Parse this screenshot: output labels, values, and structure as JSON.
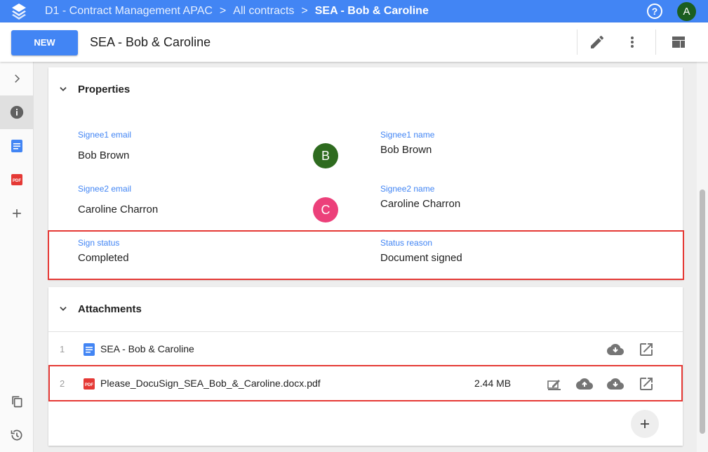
{
  "header": {
    "breadcrumbs": [
      "D1 - Contract Management APAC",
      "All contracts",
      "SEA - Bob & Caroline"
    ],
    "separator": ">",
    "help_icon": "help-circle-icon",
    "help_glyph": "?",
    "user_initial": "A"
  },
  "toolbar": {
    "new_label": "NEW",
    "title": "SEA - Bob & Caroline",
    "edit_icon": "pencil-icon",
    "more_icon": "more-vertical-icon",
    "layout_icon": "view-layout-icon"
  },
  "sidebar": {
    "items": [
      {
        "icon": "chevron-right-icon"
      },
      {
        "icon": "info-icon",
        "active": true
      },
      {
        "icon": "google-doc-icon"
      },
      {
        "icon": "pdf-icon",
        "text": "PDF"
      },
      {
        "icon": "plus-icon"
      },
      {
        "icon": "copy-icon"
      },
      {
        "icon": "history-icon"
      }
    ]
  },
  "properties": {
    "title": "Properties",
    "signee1_email_label": "Signee1 email",
    "signee1_email_value": "Bob Brown",
    "signee1_avatar": "B",
    "signee1_name_label": "Signee1 name",
    "signee1_name_value": "Bob Brown",
    "signee2_email_label": "Signee2 email",
    "signee2_email_value": "Caroline Charron",
    "signee2_avatar": "C",
    "signee2_name_label": "Signee2 name",
    "signee2_name_value": "Caroline Charron",
    "sign_status_label": "Sign status",
    "sign_status_value": "Completed",
    "status_reason_label": "Status reason",
    "status_reason_value": "Document signed"
  },
  "attachments": {
    "title": "Attachments",
    "rows": [
      {
        "num": "1",
        "icon": "google-doc-icon",
        "name": "SEA - Bob & Caroline",
        "size": ""
      },
      {
        "num": "2",
        "icon": "pdf-icon",
        "name": "Please_DocuSign_SEA_Bob_&_Caroline.docx.pdf",
        "size": "2.44 MB"
      }
    ],
    "pdf_badge": "PDF",
    "add_icon": "plus-icon"
  },
  "colors": {
    "accent": "#4285f4",
    "highlight": "#e53935",
    "avatar_b": "#2e6b1f",
    "avatar_c": "#ec407a",
    "user_avatar": "#1b5e20"
  }
}
